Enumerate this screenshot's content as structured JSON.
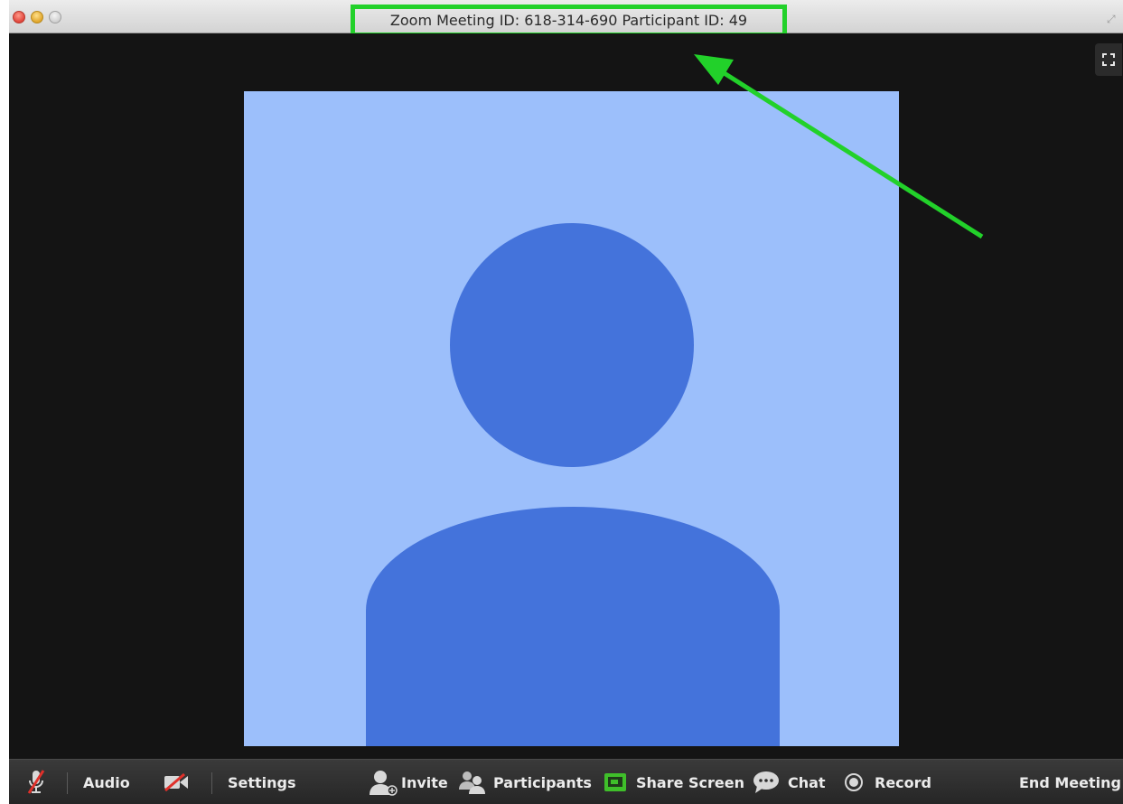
{
  "window": {
    "title": "Zoom Meeting ID: 618-314-690 Participant ID: 49"
  },
  "toolbar": {
    "audio_label": "Audio",
    "settings_label": "Settings",
    "invite_label": "Invite",
    "participants_label": "Participants",
    "share_screen_label": "Share Screen",
    "chat_label": "Chat",
    "record_label": "Record",
    "end_meeting_label": "End Meeting"
  },
  "icons": {
    "mic": "microphone-muted-icon",
    "video": "video-off-icon",
    "invite": "invite-person-icon",
    "participants": "participants-icon",
    "share": "share-screen-icon",
    "chat": "chat-bubble-icon",
    "record": "record-icon",
    "fullscreen": "fullscreen-icon"
  },
  "colors": {
    "highlight": "#22d12a",
    "avatar_bg": "#9cbffb",
    "avatar_fg": "#4473db",
    "share_icon": "#3fbf2a",
    "mute_slash": "#e0302a"
  }
}
